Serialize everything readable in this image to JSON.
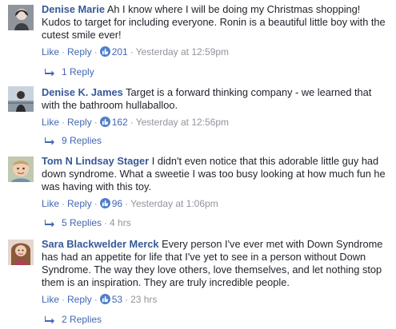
{
  "comments": [
    {
      "author": "Denise Marie",
      "text": "Ah I know where I will be doing my Christmas shopping! Kudos to target for including everyone. Ronin is a beautiful little boy with the cutest smile ever!",
      "like_label": "Like",
      "reply_label": "Reply",
      "likes": "201",
      "timestamp": "Yesterday at 12:59pm",
      "replies_label": "1 Reply",
      "replies_meta": ""
    },
    {
      "author": "Denise K. James",
      "text": "Target is a forward thinking company - we learned that with the bathroom hullaballoo.",
      "like_label": "Like",
      "reply_label": "Reply",
      "likes": "162",
      "timestamp": "Yesterday at 12:56pm",
      "replies_label": "9 Replies",
      "replies_meta": ""
    },
    {
      "author": "Tom N Lindsay Stager",
      "text": "I didn't even notice that this adorable little guy had down syndrome. What a sweetie I was too busy looking at how much fun he was having with this toy.",
      "like_label": "Like",
      "reply_label": "Reply",
      "likes": "96",
      "timestamp": "Yesterday at 1:06pm",
      "replies_label": "5 Replies",
      "replies_meta": "4 hrs"
    },
    {
      "author": "Sara Blackwelder Merck",
      "text": "Every person I've ever met with Down Syndrome has had an appetite for life that I've yet to see in a person without Down Syndrome. The way they love others, love themselves, and let nothing stop them is an inspiration. They are truly incredible people.",
      "like_label": "Like",
      "reply_label": "Reply",
      "likes": "53",
      "timestamp": "23 hrs",
      "replies_label": "2 Replies",
      "replies_meta": ""
    }
  ],
  "separator": "·",
  "icons": {
    "like": "thumbs-up-icon",
    "reply": "reply-arrow-icon"
  },
  "colors": {
    "link": "#4267b2",
    "author": "#365899",
    "muted": "#90949c",
    "like_badge": "#4f7ecb"
  }
}
